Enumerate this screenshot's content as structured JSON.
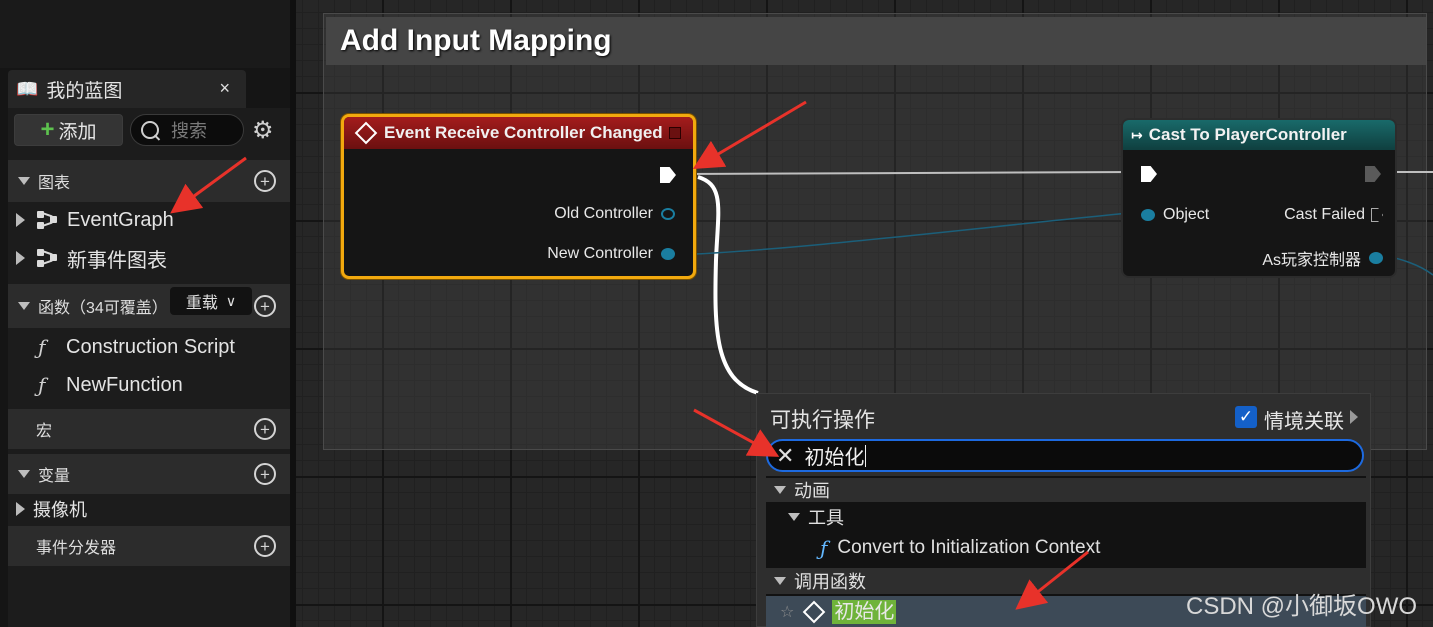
{
  "left_panel": {
    "tab_title": "我的蓝图",
    "close_glyph": "×",
    "add_label": "添加",
    "search_placeholder": "搜索",
    "sections": {
      "graphs": "图表",
      "functions": "函数（34可覆盖）",
      "override_label": "重载",
      "macros": "宏",
      "variables": "变量",
      "dispatchers": "事件分发器"
    },
    "graph_items": [
      "EventGraph",
      "新事件图表"
    ],
    "function_items": [
      "Construction Script",
      "NewFunction"
    ],
    "variable_items": [
      "摄像机"
    ]
  },
  "graph": {
    "comment_title": "Add Input Mapping",
    "event_node": {
      "title": "Event Receive Controller Changed",
      "pins": [
        "Old Controller",
        "New Controller"
      ]
    },
    "cast_node": {
      "title": "Cast To PlayerController",
      "input_pin": "Object",
      "output_pins": [
        "Cast Failed",
        "As玩家控制器"
      ]
    }
  },
  "action_menu": {
    "title": "可执行操作",
    "context_checked": true,
    "context_label": "情境关联",
    "search_value": "初始化",
    "categories": {
      "animation": "动画",
      "tools": "工具",
      "call_function": "调用函数"
    },
    "tool_result": "Convert to Initialization Context",
    "selected_result": "初始化"
  },
  "watermark": "CSDN @小御坂OWO",
  "colors": {
    "event_header": "#a41c1c",
    "cast_header": "#196a6a",
    "selected_border": "#f2a90e",
    "annotation_arrow": "#e8322a",
    "search_focus": "#1d6ae0",
    "highlight": "#6fb33a"
  }
}
